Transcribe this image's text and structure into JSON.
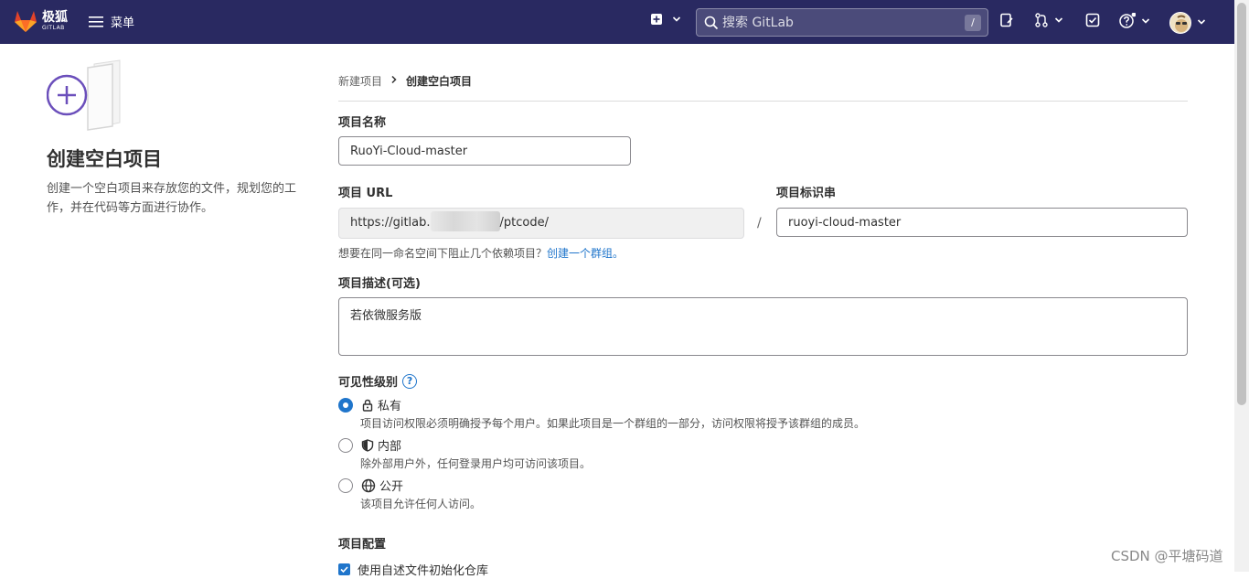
{
  "navbar": {
    "brand_name": "极狐",
    "brand_sub": "GITLAB",
    "menu_label": "菜单",
    "search_placeholder": "搜索 GitLab",
    "search_shortcut": "/"
  },
  "sidebar": {
    "title": "创建空白项目",
    "description": "创建一个空白项目来存放您的文件，规划您的工作，并在代码等方面进行协作。"
  },
  "breadcrumb": {
    "parent": "新建项目",
    "current": "创建空白项目"
  },
  "form": {
    "project_name_label": "项目名称",
    "project_name_value": "RuoYi-Cloud-master",
    "project_url_label": "项目 URL",
    "project_url_prefix": "https://gitlab.",
    "project_url_suffix": "/ptcode/",
    "slug_separator": "/",
    "project_slug_label": "项目标识串",
    "project_slug_value": "ruoyi-cloud-master",
    "namespace_hint": "想要在同一命名空间下阻止几个依赖项目？",
    "namespace_link": "创建一个群组。",
    "description_label": "项目描述(可选)",
    "description_value": "若依微服务版",
    "visibility_label": "可见性级别",
    "visibility_help": "?",
    "visibility_options": [
      {
        "label": "私有",
        "help": "项目访问权限必须明确授予每个用户。如果此项目是一个群组的一部分，访问权限将授予该群组的成员。",
        "checked": true,
        "icon": "lock-icon"
      },
      {
        "label": "内部",
        "help": "除外部用户外，任何登录用户均可访问该项目。",
        "checked": false,
        "icon": "shield-icon"
      },
      {
        "label": "公开",
        "help": "该项目允许任何人访问。",
        "checked": false,
        "icon": "globe-icon"
      }
    ],
    "config_label": "项目配置",
    "readme_checkbox_label": "使用自述文件初始化仓库"
  },
  "watermark": "CSDN @平塘码道"
}
